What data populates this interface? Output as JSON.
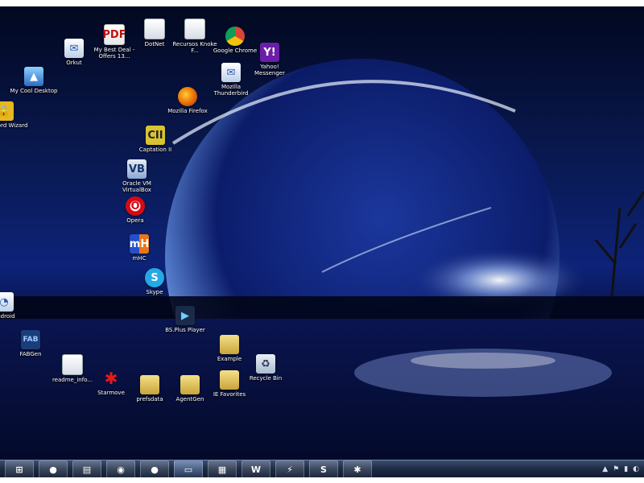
{
  "desktop_icons": [
    {
      "label": "Orkut",
      "icon": "orkut-icon",
      "cls": "app"
    },
    {
      "label": "My Best Deal - Offers 13...",
      "icon": "pdf-document-icon",
      "cls": "pdf"
    },
    {
      "label": "DotNet",
      "icon": "document-icon",
      "cls": "doc"
    },
    {
      "label": "Recursos Knoke F...",
      "icon": "document-icon",
      "cls": "doc"
    },
    {
      "label": "Google Chrome",
      "icon": "chrome-icon",
      "cls": "chrome"
    },
    {
      "label": "Yahoo! Messenger",
      "icon": "yahoo-messenger-icon",
      "cls": "yahoo"
    },
    {
      "label": "My Cool Desktop",
      "icon": "desktop-app-icon",
      "cls": "mydesk"
    },
    {
      "label": "Mozilla Thunderbird",
      "icon": "thunderbird-icon",
      "cls": "app"
    },
    {
      "label": "Mozilla Firefox",
      "icon": "firefox-icon",
      "cls": "firefox"
    },
    {
      "label": "Password Wizard",
      "icon": "lock-icon",
      "cls": "keypass"
    },
    {
      "label": "Captation II",
      "icon": "capture-icon",
      "cls": "capt"
    },
    {
      "label": "Oracle VM VirtualBox",
      "icon": "virtualbox-icon",
      "cls": "vbox"
    },
    {
      "label": "Opera",
      "icon": "opera-icon",
      "cls": "opera"
    },
    {
      "label": "mHC",
      "icon": "mhc-icon",
      "cls": "mhc"
    },
    {
      "label": "Skype",
      "icon": "skype-icon",
      "cls": "skype"
    },
    {
      "label": "Android",
      "icon": "android-icon",
      "cls": "app"
    },
    {
      "label": "BS.Plus Player",
      "icon": "media-player-icon",
      "cls": "bsplayer"
    },
    {
      "label": "FABGen",
      "icon": "fabgen-icon",
      "cls": "fab"
    },
    {
      "label": "Example",
      "icon": "folder-icon",
      "cls": "folder"
    },
    {
      "label": "Recycle Bin",
      "icon": "recycle-bin-icon",
      "cls": "recycle"
    },
    {
      "label": "readme_info...",
      "icon": "document-icon",
      "cls": "doc"
    },
    {
      "label": "Starmove",
      "icon": "starmove-icon",
      "cls": "starmove"
    },
    {
      "label": "prefsdata",
      "icon": "folder-icon",
      "cls": "folder"
    },
    {
      "label": "AgentGen",
      "icon": "folder-icon",
      "cls": "folder"
    },
    {
      "label": "IE Favorites",
      "icon": "folder-icon",
      "cls": "folder"
    }
  ],
  "taskbar": {
    "buttons": [
      {
        "name": "start-button",
        "glyph": "⊞"
      },
      {
        "name": "firefox-taskbar-button",
        "glyph": "●"
      },
      {
        "name": "explorer-taskbar-button",
        "glyph": "▤"
      },
      {
        "name": "messenger-taskbar-button",
        "glyph": "◉"
      },
      {
        "name": "green-app-taskbar-button",
        "glyph": "●"
      },
      {
        "name": "window-taskbar-button",
        "glyph": "▭"
      },
      {
        "name": "notepad-taskbar-button",
        "glyph": "▦"
      },
      {
        "name": "word-taskbar-button",
        "glyph": "W"
      },
      {
        "name": "winamp-taskbar-button",
        "glyph": "⚡"
      },
      {
        "name": "skype-taskbar-button",
        "glyph": "S"
      },
      {
        "name": "starmove-taskbar-button",
        "glyph": "✱"
      }
    ],
    "tray": [
      "▲",
      "⚑",
      "▮",
      "◐"
    ]
  }
}
